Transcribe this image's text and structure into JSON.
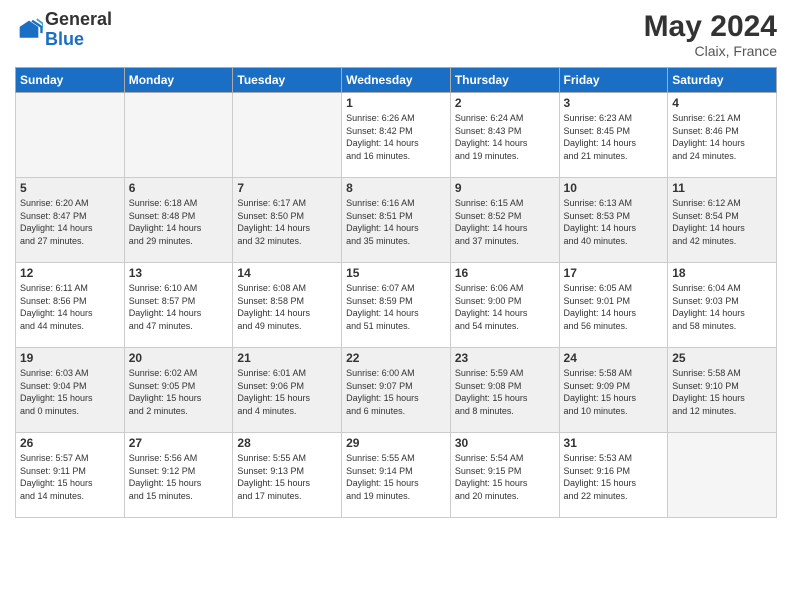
{
  "header": {
    "logo_general": "General",
    "logo_blue": "Blue",
    "month_title": "May 2024",
    "subtitle": "Claix, France"
  },
  "weekdays": [
    "Sunday",
    "Monday",
    "Tuesday",
    "Wednesday",
    "Thursday",
    "Friday",
    "Saturday"
  ],
  "weeks": [
    [
      {
        "day": "",
        "info": ""
      },
      {
        "day": "",
        "info": ""
      },
      {
        "day": "",
        "info": ""
      },
      {
        "day": "1",
        "info": "Sunrise: 6:26 AM\nSunset: 8:42 PM\nDaylight: 14 hours\nand 16 minutes."
      },
      {
        "day": "2",
        "info": "Sunrise: 6:24 AM\nSunset: 8:43 PM\nDaylight: 14 hours\nand 19 minutes."
      },
      {
        "day": "3",
        "info": "Sunrise: 6:23 AM\nSunset: 8:45 PM\nDaylight: 14 hours\nand 21 minutes."
      },
      {
        "day": "4",
        "info": "Sunrise: 6:21 AM\nSunset: 8:46 PM\nDaylight: 14 hours\nand 24 minutes."
      }
    ],
    [
      {
        "day": "5",
        "info": "Sunrise: 6:20 AM\nSunset: 8:47 PM\nDaylight: 14 hours\nand 27 minutes."
      },
      {
        "day": "6",
        "info": "Sunrise: 6:18 AM\nSunset: 8:48 PM\nDaylight: 14 hours\nand 29 minutes."
      },
      {
        "day": "7",
        "info": "Sunrise: 6:17 AM\nSunset: 8:50 PM\nDaylight: 14 hours\nand 32 minutes."
      },
      {
        "day": "8",
        "info": "Sunrise: 6:16 AM\nSunset: 8:51 PM\nDaylight: 14 hours\nand 35 minutes."
      },
      {
        "day": "9",
        "info": "Sunrise: 6:15 AM\nSunset: 8:52 PM\nDaylight: 14 hours\nand 37 minutes."
      },
      {
        "day": "10",
        "info": "Sunrise: 6:13 AM\nSunset: 8:53 PM\nDaylight: 14 hours\nand 40 minutes."
      },
      {
        "day": "11",
        "info": "Sunrise: 6:12 AM\nSunset: 8:54 PM\nDaylight: 14 hours\nand 42 minutes."
      }
    ],
    [
      {
        "day": "12",
        "info": "Sunrise: 6:11 AM\nSunset: 8:56 PM\nDaylight: 14 hours\nand 44 minutes."
      },
      {
        "day": "13",
        "info": "Sunrise: 6:10 AM\nSunset: 8:57 PM\nDaylight: 14 hours\nand 47 minutes."
      },
      {
        "day": "14",
        "info": "Sunrise: 6:08 AM\nSunset: 8:58 PM\nDaylight: 14 hours\nand 49 minutes."
      },
      {
        "day": "15",
        "info": "Sunrise: 6:07 AM\nSunset: 8:59 PM\nDaylight: 14 hours\nand 51 minutes."
      },
      {
        "day": "16",
        "info": "Sunrise: 6:06 AM\nSunset: 9:00 PM\nDaylight: 14 hours\nand 54 minutes."
      },
      {
        "day": "17",
        "info": "Sunrise: 6:05 AM\nSunset: 9:01 PM\nDaylight: 14 hours\nand 56 minutes."
      },
      {
        "day": "18",
        "info": "Sunrise: 6:04 AM\nSunset: 9:03 PM\nDaylight: 14 hours\nand 58 minutes."
      }
    ],
    [
      {
        "day": "19",
        "info": "Sunrise: 6:03 AM\nSunset: 9:04 PM\nDaylight: 15 hours\nand 0 minutes."
      },
      {
        "day": "20",
        "info": "Sunrise: 6:02 AM\nSunset: 9:05 PM\nDaylight: 15 hours\nand 2 minutes."
      },
      {
        "day": "21",
        "info": "Sunrise: 6:01 AM\nSunset: 9:06 PM\nDaylight: 15 hours\nand 4 minutes."
      },
      {
        "day": "22",
        "info": "Sunrise: 6:00 AM\nSunset: 9:07 PM\nDaylight: 15 hours\nand 6 minutes."
      },
      {
        "day": "23",
        "info": "Sunrise: 5:59 AM\nSunset: 9:08 PM\nDaylight: 15 hours\nand 8 minutes."
      },
      {
        "day": "24",
        "info": "Sunrise: 5:58 AM\nSunset: 9:09 PM\nDaylight: 15 hours\nand 10 minutes."
      },
      {
        "day": "25",
        "info": "Sunrise: 5:58 AM\nSunset: 9:10 PM\nDaylight: 15 hours\nand 12 minutes."
      }
    ],
    [
      {
        "day": "26",
        "info": "Sunrise: 5:57 AM\nSunset: 9:11 PM\nDaylight: 15 hours\nand 14 minutes."
      },
      {
        "day": "27",
        "info": "Sunrise: 5:56 AM\nSunset: 9:12 PM\nDaylight: 15 hours\nand 15 minutes."
      },
      {
        "day": "28",
        "info": "Sunrise: 5:55 AM\nSunset: 9:13 PM\nDaylight: 15 hours\nand 17 minutes."
      },
      {
        "day": "29",
        "info": "Sunrise: 5:55 AM\nSunset: 9:14 PM\nDaylight: 15 hours\nand 19 minutes."
      },
      {
        "day": "30",
        "info": "Sunrise: 5:54 AM\nSunset: 9:15 PM\nDaylight: 15 hours\nand 20 minutes."
      },
      {
        "day": "31",
        "info": "Sunrise: 5:53 AM\nSunset: 9:16 PM\nDaylight: 15 hours\nand 22 minutes."
      },
      {
        "day": "",
        "info": ""
      }
    ]
  ]
}
